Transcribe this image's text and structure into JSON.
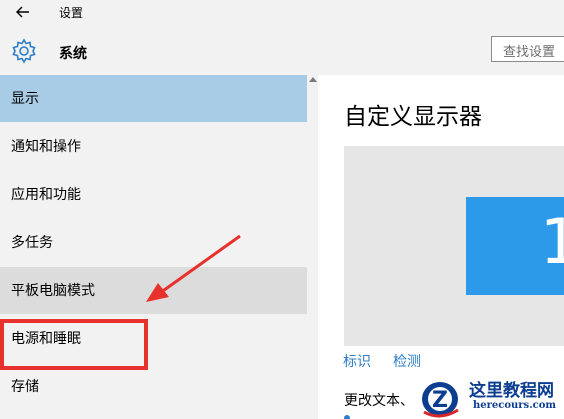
{
  "window": {
    "title": "设置"
  },
  "header": {
    "section_title": "系统",
    "search_placeholder": "查找设置"
  },
  "sidebar": {
    "items": [
      {
        "label": "显示",
        "state": "selected"
      },
      {
        "label": "通知和操作",
        "state": "normal"
      },
      {
        "label": "应用和功能",
        "state": "normal"
      },
      {
        "label": "多任务",
        "state": "normal"
      },
      {
        "label": "平板电脑模式",
        "state": "hover"
      },
      {
        "label": "电源和睡眠",
        "state": "normal"
      },
      {
        "label": "存储",
        "state": "normal"
      }
    ]
  },
  "content": {
    "title": "自定义显示器",
    "monitor_number": "1",
    "links": {
      "identify": "标识",
      "detect": "检测"
    },
    "change_text": "更改文本、"
  },
  "watermark": {
    "name": "这里教程网",
    "url": "herecours.com"
  },
  "colors": {
    "selected": "#a8cce6",
    "hover": "#dcdcdc",
    "accent": "#2d9ae9",
    "link": "#2d7dc7",
    "annotation": "#e8302c"
  },
  "icons": {
    "back": "back-arrow-icon",
    "settings": "gear-icon"
  }
}
